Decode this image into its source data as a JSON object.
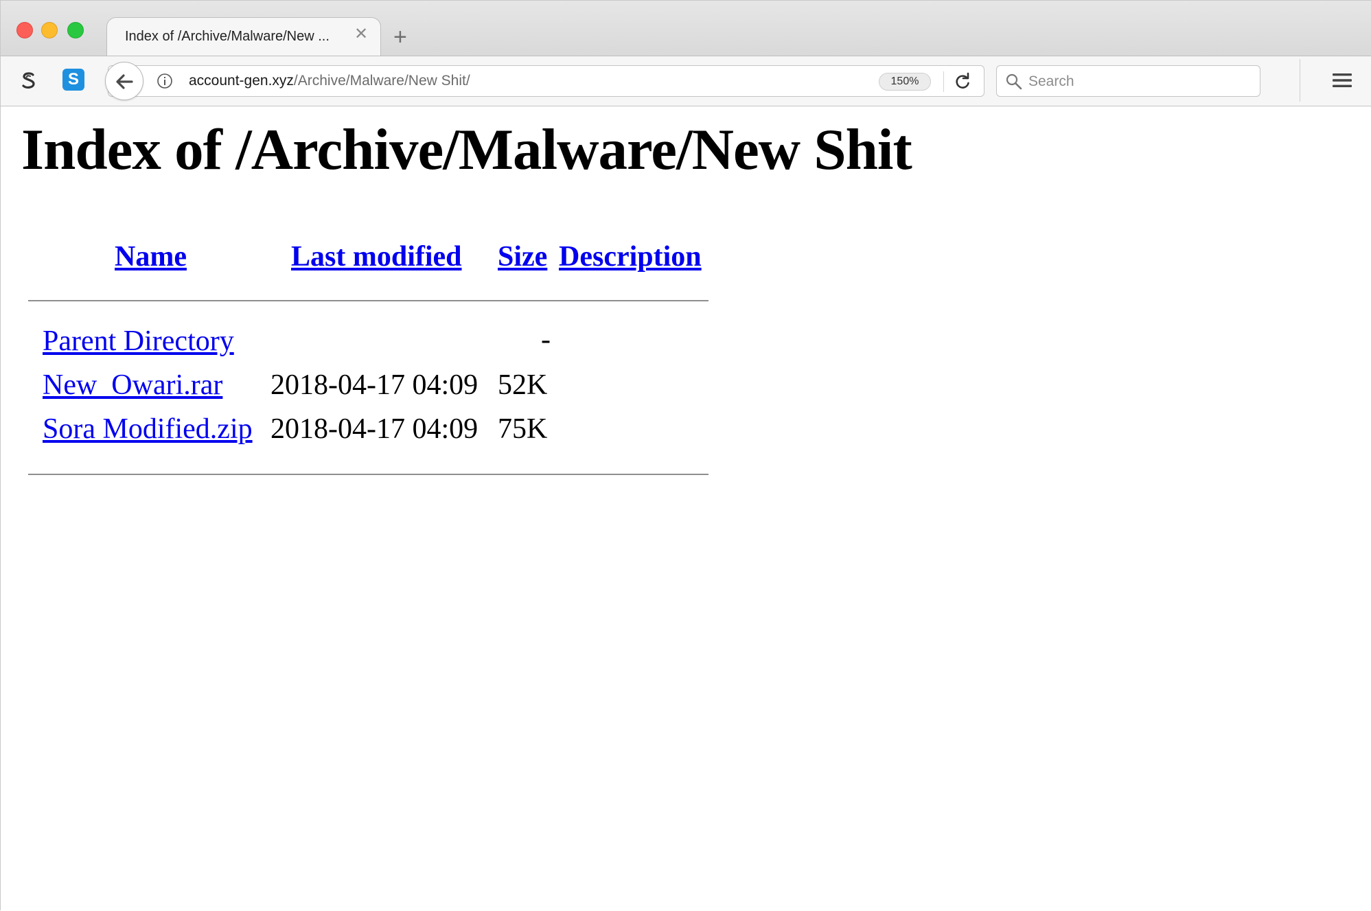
{
  "browser": {
    "tab": {
      "title": "Index of /Archive/Malware/New ...",
      "close_glyph": "✕"
    },
    "new_tab_glyph": "+",
    "extension_blue_label": "S",
    "url": {
      "host": "account-gen.xyz",
      "path": "/Archive/Malware/New Shit/"
    },
    "zoom": "150%",
    "search_placeholder": "Search",
    "icons": {
      "back": "back-arrow-icon",
      "info": "info-icon",
      "reload": "reload-icon",
      "search": "search-icon",
      "menu": "hamburger-menu-icon",
      "extension_s": "s-extension-icon"
    }
  },
  "page": {
    "heading": "Index of /Archive/Malware/New Shit",
    "columns": {
      "name": "Name",
      "last_modified": "Last modified",
      "size": "Size",
      "description": "Description"
    },
    "rows": [
      {
        "name": "Parent Directory",
        "last_modified": "",
        "size": "-",
        "description": ""
      },
      {
        "name": "New_Owari.rar",
        "last_modified": "2018-04-17 04:09",
        "size": "52K",
        "description": ""
      },
      {
        "name": "Sora Modified.zip",
        "last_modified": "2018-04-17 04:09",
        "size": "75K",
        "description": ""
      }
    ]
  },
  "colors": {
    "link": "#0000ee",
    "traffic_close": "#fc5f57",
    "traffic_minimize": "#fdbc2e",
    "traffic_maximize": "#29c840"
  }
}
